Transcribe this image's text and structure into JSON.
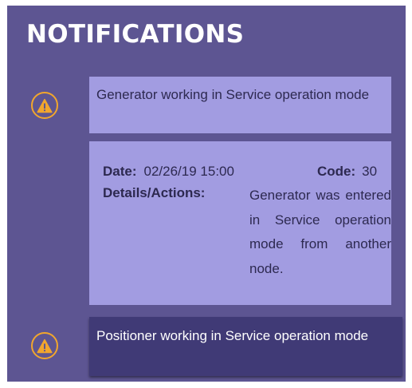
{
  "panel": {
    "title": "NOTIFICATIONS"
  },
  "notifications": [
    {
      "icon": "warning-icon",
      "message": "Generator working in Service operation mode",
      "expanded": true,
      "date_label": "Date:",
      "date_value": "02/26/19 15:00",
      "code_label": "Code:",
      "code_value": "30",
      "details_label": "Details/Actions:",
      "details_text": "Generator was entered in Service operation mode from another node."
    },
    {
      "icon": "warning-icon",
      "message": "Positioner working in Service operation mode",
      "expanded": false
    }
  ],
  "colors": {
    "panel_bg": "#5d5592",
    "card_bg": "#a29ce1",
    "selected_card_bg": "#403a76",
    "warning": "#f1a62d"
  }
}
